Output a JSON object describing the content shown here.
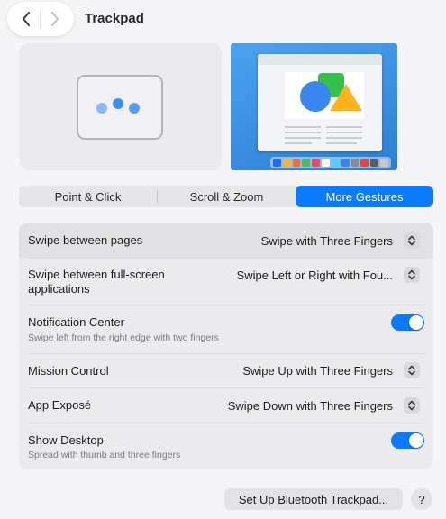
{
  "header": {
    "title": "Trackpad",
    "back_icon": "chevron-left-icon",
    "forward_icon": "chevron-right-icon"
  },
  "tabs": [
    {
      "label": "Point & Click",
      "active": false
    },
    {
      "label": "Scroll & Zoom",
      "active": false
    },
    {
      "label": "More Gestures",
      "active": true
    }
  ],
  "settings": {
    "swipe_pages": {
      "label": "Swipe between pages",
      "value": "Swipe with Three Fingers"
    },
    "swipe_fullscreen": {
      "label": "Swipe between full-screen applications",
      "value": "Swipe Left or Right with Fou..."
    },
    "notification_center": {
      "label": "Notification Center",
      "description": "Swipe left from the right edge with two fingers",
      "enabled": true
    },
    "mission_control": {
      "label": "Mission Control",
      "value": "Swipe Up with Three Fingers"
    },
    "app_expose": {
      "label": "App Exposé",
      "value": "Swipe Down with Three Fingers"
    },
    "show_desktop": {
      "label": "Show Desktop",
      "description": "Spread with thumb and three fingers",
      "enabled": true
    }
  },
  "footer": {
    "setup_bluetooth_label": "Set Up Bluetooth Trackpad...",
    "help_label": "?"
  },
  "colors": {
    "accent": "#0a7aff",
    "background": "#f5f4f6"
  }
}
